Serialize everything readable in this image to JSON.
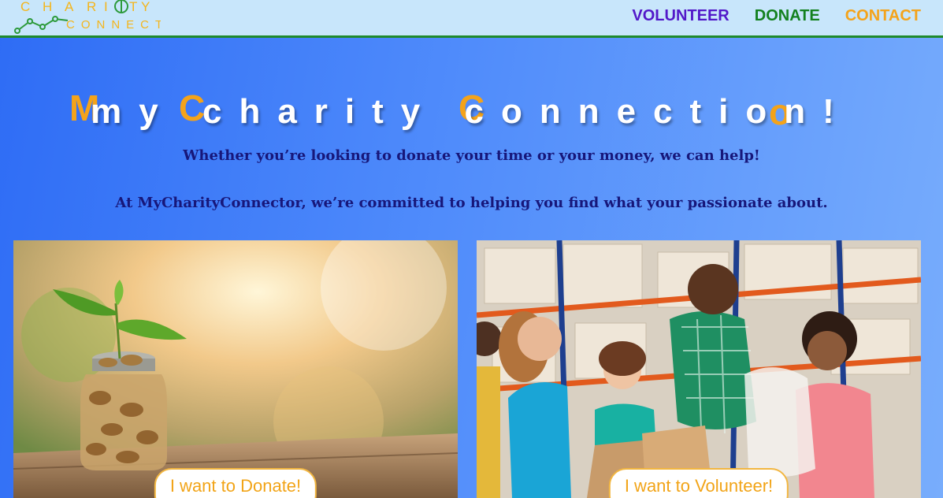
{
  "logo": {
    "line1": "CHARITY",
    "line2": "CONNECT"
  },
  "nav": {
    "volunteer": {
      "label": "VOLUNTEER",
      "color": "#5218c9"
    },
    "donate": {
      "label": "DONATE",
      "color": "#14811f"
    },
    "contact": {
      "label": "CONTACT",
      "color": "#f4a31a"
    }
  },
  "hero": {
    "title_front": "my charity connection!",
    "title_accents": [
      "M",
      "C",
      "C",
      "o"
    ],
    "accent_color": "#f4a31a",
    "tagline1": "Whether you’re looking to donate your time or your money, we can help!",
    "tagline2": "At MyCharityConnector, we’re committed to helping you find what your passionate about."
  },
  "cards": [
    {
      "image_icon": "plant-coin-jar-photo",
      "button_label": "I want to Donate!"
    },
    {
      "image_icon": "volunteers-food-drive-photo",
      "button_label": "I want to Volunteer!"
    }
  ]
}
